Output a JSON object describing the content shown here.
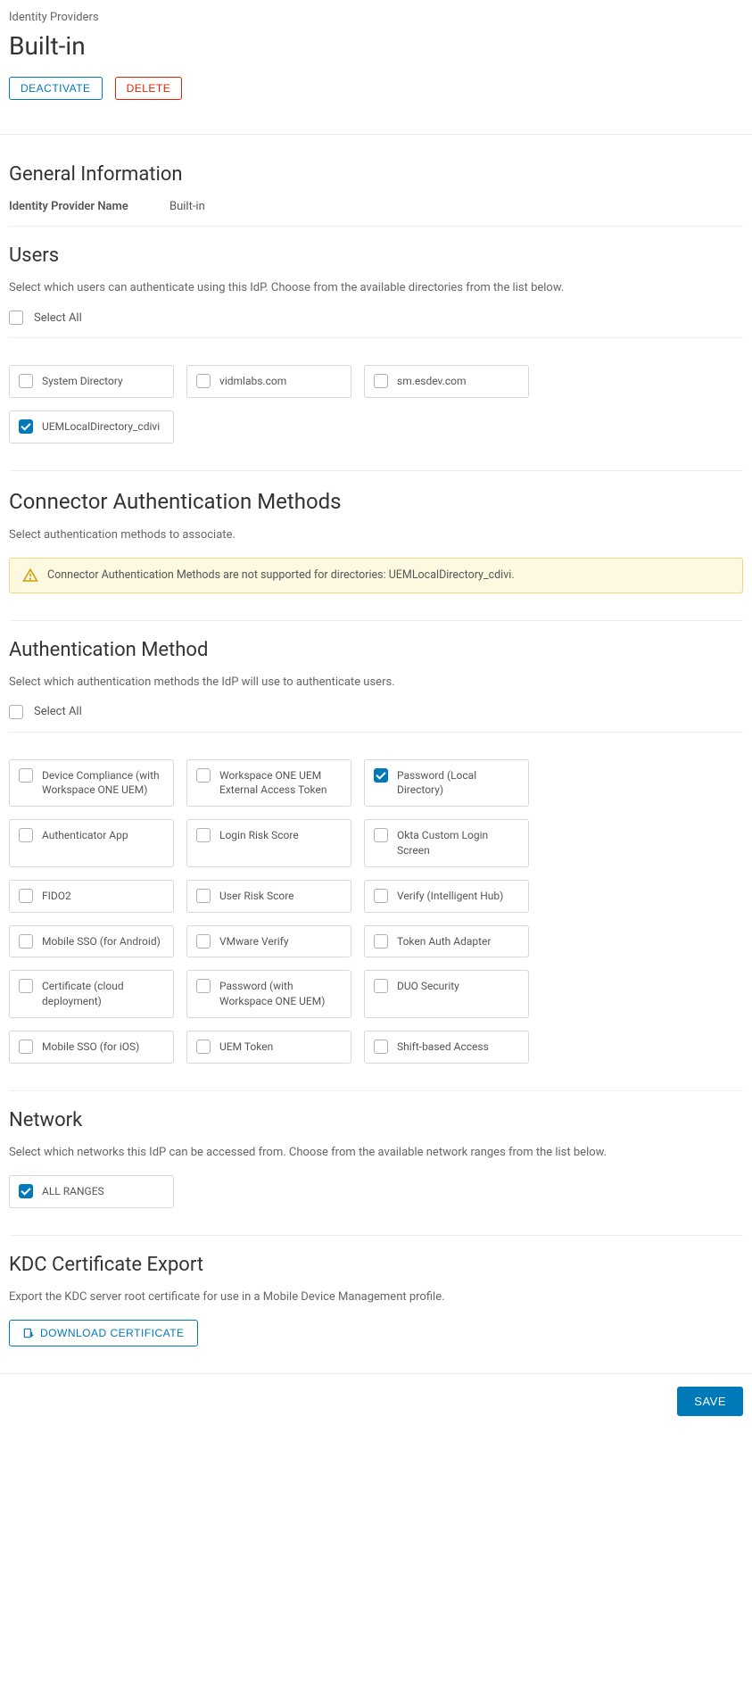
{
  "breadcrumb": "Identity Providers",
  "title": "Built-in",
  "actions": {
    "deactivate": "DEACTIVATE",
    "delete": "DELETE",
    "save": "SAVE",
    "download": "DOWNLOAD CERTIFICATE"
  },
  "general": {
    "heading": "General Information",
    "name_label": "Identity Provider Name",
    "name_value": "Built-in"
  },
  "users": {
    "heading": "Users",
    "description": "Select which users can authenticate using this IdP. Choose from the available directories from the list below.",
    "select_all": "Select All",
    "items": [
      {
        "label": "System Directory",
        "checked": false
      },
      {
        "label": "vidmlabs.com",
        "checked": false
      },
      {
        "label": "sm.esdev.com",
        "checked": false
      },
      {
        "label": "UEMLocalDirectory_cdivi",
        "checked": true
      }
    ]
  },
  "connector": {
    "heading": "Connector Authentication Methods",
    "description": "Select authentication methods to associate.",
    "warning": "Connector Authentication Methods are not supported for directories: UEMLocalDirectory_cdivi."
  },
  "auth_method": {
    "heading": "Authentication Method",
    "description": "Select which authentication methods the IdP will use to authenticate users.",
    "select_all": "Select All",
    "items": [
      {
        "label": "Device Compliance (with Workspace ONE UEM)",
        "checked": false
      },
      {
        "label": "Workspace ONE UEM External Access Token",
        "checked": false
      },
      {
        "label": "Password (Local Directory)",
        "checked": true
      },
      {
        "label": "Authenticator App",
        "checked": false
      },
      {
        "label": "Login Risk Score",
        "checked": false
      },
      {
        "label": "Okta Custom Login Screen",
        "checked": false
      },
      {
        "label": "FIDO2",
        "checked": false
      },
      {
        "label": "User Risk Score",
        "checked": false
      },
      {
        "label": "Verify (Intelligent Hub)",
        "checked": false
      },
      {
        "label": "Mobile SSO (for Android)",
        "checked": false
      },
      {
        "label": "VMware Verify",
        "checked": false
      },
      {
        "label": "Token Auth Adapter",
        "checked": false
      },
      {
        "label": "Certificate (cloud deployment)",
        "checked": false
      },
      {
        "label": "Password (with Workspace ONE UEM)",
        "checked": false
      },
      {
        "label": "DUO Security",
        "checked": false
      },
      {
        "label": "Mobile SSO (for iOS)",
        "checked": false
      },
      {
        "label": "UEM Token",
        "checked": false
      },
      {
        "label": "Shift-based Access",
        "checked": false
      }
    ]
  },
  "network": {
    "heading": "Network",
    "description": "Select which networks this IdP can be accessed from. Choose from the available network ranges from the list below.",
    "items": [
      {
        "label": "ALL RANGES",
        "checked": true
      }
    ]
  },
  "kdc": {
    "heading": "KDC Certificate Export",
    "description": "Export the KDC server root certificate for use in a Mobile Device Management profile."
  }
}
